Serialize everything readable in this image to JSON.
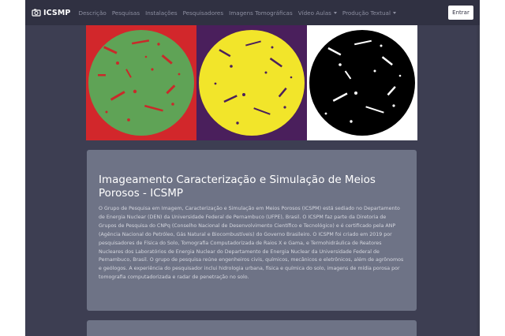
{
  "navbar": {
    "brand": "ICSMP",
    "items": [
      {
        "label": "Descrição",
        "active": true,
        "dropdown": false
      },
      {
        "label": "Pesquisas",
        "active": false,
        "dropdown": false
      },
      {
        "label": "Instalações",
        "active": false,
        "dropdown": false
      },
      {
        "label": "Pesquisadores",
        "active": false,
        "dropdown": false
      },
      {
        "label": "Imagens Tomográficas",
        "active": true,
        "dropdown": false
      },
      {
        "label": "Vídeo Aulas",
        "active": false,
        "dropdown": true
      },
      {
        "label": "Produção Textual",
        "active": false,
        "dropdown": true
      }
    ],
    "login_label": "Entrar"
  },
  "banner": {
    "panels": [
      {
        "name": "red-green-tomography",
        "background": "#d2272b",
        "disk": "#5fa356",
        "speck": "#c92a2a"
      },
      {
        "name": "purple-yellow-tomography",
        "background": "#4a1f5c",
        "disk": "#f2e52a",
        "speck": "#4a1f5c"
      },
      {
        "name": "white-black-tomography",
        "background": "#ffffff",
        "disk": "#000000",
        "speck": "#ffffff"
      }
    ]
  },
  "intro": {
    "title": "Imageamento Caracterização e Simulação de Meios Porosos - ICSMP",
    "body": "O Grupo de Pesquisa em Imagem, Caracterização e Simulação em Meios Porosos (ICSPM) está sediado no Departamento de Energia Nuclear (DEN) da Universidade Federal de Pernambuco (UFPE), Brasil. O ICSPM faz parte da Diretoria de Grupos de Pesquisa do CNPq (Conselho Nacional de Desenvolvimento Científico e Tecnológico) e é certificado pela ANP (Agência Nacional do Petróleo, Gás Natural e Biocombustíveis) do Governo Brasileiro. O ICSPM foi criado em 2019 por pesquisadores de Física do Solo, Tomografia Computadorizada de Raios X e Gama, e Termohidráulica de Reatores Nucleares dos Laboratórios de Energia Nuclear do Departamento de Energia Nuclear da Universidade Federal de Pernambuco, Brasil. O grupo de pesquisa reúne engenheiros civis, químicos, mecânicos e eletrônicos, além de agrônomos e geólogos. A experiência do pesquisador inclui hidrologia urbana, física e química do solo, imagens de mídia porosa por tomografia computadorizada e radar de penetração no solo."
  }
}
